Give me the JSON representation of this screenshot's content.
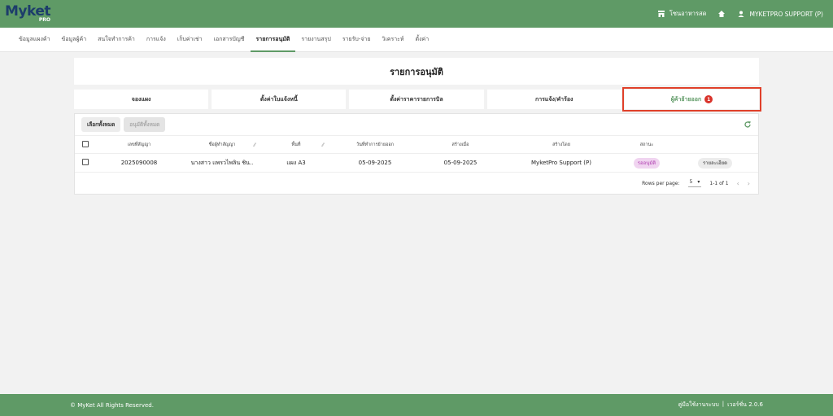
{
  "app": {
    "logo": "Myket",
    "logo_sub": "PRO"
  },
  "topbar": {
    "store_label": "โซนอาหารสด",
    "user_label": "MYKETPRO SUPPORT (P)"
  },
  "nav": {
    "tabs": [
      "ข้อมูลแผงค้า",
      "ข้อมูลผู้ค้า",
      "สนใจทำการค้า",
      "การแจ้ง",
      "เก็บค่าเช่า",
      "เอกสารบัญชี",
      "รายการอนุมัติ",
      "รายงานสรุป",
      "รายรับ-จ่าย",
      "วิเคราะห์",
      "ตั้งค่า"
    ],
    "active_index": 6
  },
  "page": {
    "title": "รายการอนุมัติ"
  },
  "subtabs": {
    "items": [
      "จองแผง",
      "ตั้งค่าใบแจ้งหนี้",
      "ตั้งค่าราคารายการบิล",
      "การแจ้ง/คำร้อง",
      "ผู้ค้าย้ายออก"
    ],
    "active_index": 4,
    "badge": "1"
  },
  "toolbar": {
    "select_all": "เลือกทั้งหมด",
    "approve_all": "อนุมัติทั้งหมด"
  },
  "table": {
    "headers": [
      "เลขที่สัญญา",
      "ชื่อผู้ทำสัญญา",
      "พื้นที่",
      "วันที่ทำการย้ายออก",
      "สร้างเมื่อ",
      "สร้างโดย",
      "สถานะ"
    ],
    "rows": [
      {
        "contract": "2025090008",
        "name": "นางสาว แพรวไพลิน ชิน..",
        "area": "แผง A3",
        "move_date": "05-09-2025",
        "created": "05-09-2025",
        "created_by": "MyketPro Support (P)",
        "status": "รออนุมัติ",
        "action": "รายละเอียด"
      }
    ]
  },
  "pager": {
    "rows_label": "Rows per page:",
    "rows_value": "5",
    "range": "1-1 of 1"
  },
  "footer": {
    "copyright": "© MyKet All Rights Reserved.",
    "manual": "คู่มือใช้งานระบบ",
    "separator": "|",
    "version": "เวอร์ชั่น 2.0.6"
  },
  "colors": {
    "brand": "#5f9a66",
    "highlight": "#e0402a",
    "badge": "#d9332b"
  }
}
